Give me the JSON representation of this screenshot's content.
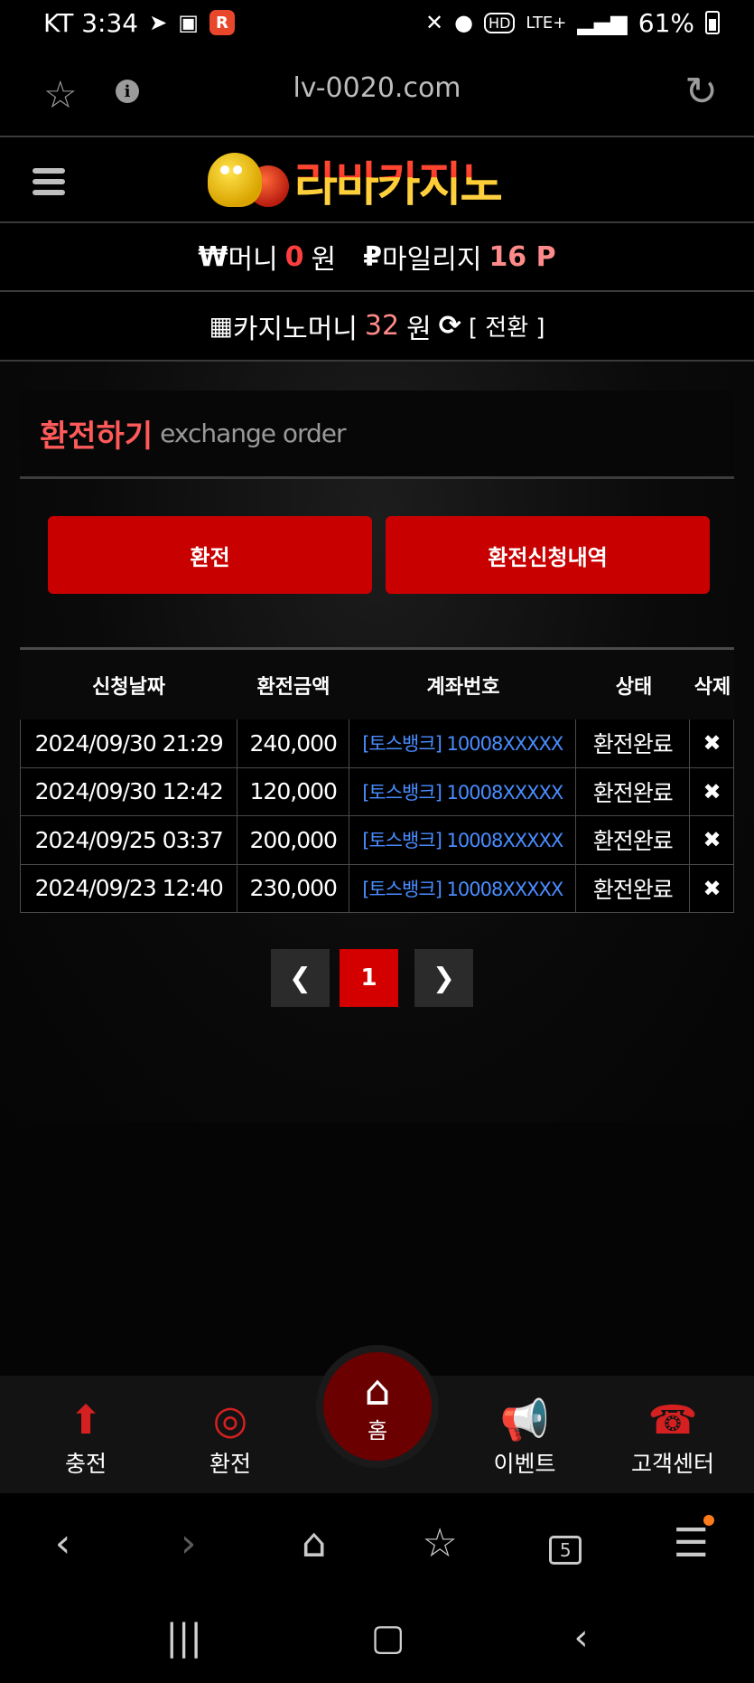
{
  "status_bar": {
    "carrier_time": "KT 3:34",
    "network": "LTE+",
    "battery": "61%"
  },
  "browser": {
    "url": "lv-0020.com"
  },
  "site": {
    "logo_text": "라바카지노",
    "money": {
      "won_symbol": "₩",
      "money_label": "머니",
      "money_value": "0",
      "money_unit": "원",
      "mileage_symbol": "₽",
      "mileage_label": "마일리지",
      "mileage_value": "16 P"
    },
    "casino_money": {
      "label": "카지노머니",
      "value": "32",
      "unit": "원",
      "convert_label": "[ 전환 ]"
    }
  },
  "page": {
    "title_ko": "환전하기",
    "title_en": "exchange order",
    "buttons": {
      "exchange": "환전",
      "history": "환전신청내역"
    },
    "table": {
      "headers": [
        "신청날짜",
        "환전금액",
        "계좌번호",
        "상태",
        "삭제"
      ],
      "rows": [
        {
          "date": "2024/09/30 21:29",
          "amount": "240,000",
          "account": "[토스뱅크] 10008XXXXX",
          "status": "환전완료"
        },
        {
          "date": "2024/09/30 12:42",
          "amount": "120,000",
          "account": "[토스뱅크] 10008XXXXX",
          "status": "환전완료"
        },
        {
          "date": "2024/09/25 03:37",
          "amount": "200,000",
          "account": "[토스뱅크] 10008XXXXX",
          "status": "환전완료"
        },
        {
          "date": "2024/09/23 12:40",
          "amount": "230,000",
          "account": "[토스뱅크] 10008XXXXX",
          "status": "환전완료"
        }
      ]
    },
    "pagination": {
      "current": "1"
    }
  },
  "bottom_nav": {
    "deposit": "충전",
    "exchange": "환전",
    "home": "홈",
    "event": "이벤트",
    "support": "고객센터"
  },
  "browser_toolbar": {
    "tab_count": "5"
  },
  "colors": {
    "accent_red": "#c80000",
    "title_red": "#ff5a5a",
    "link_blue": "#4a8cff"
  }
}
